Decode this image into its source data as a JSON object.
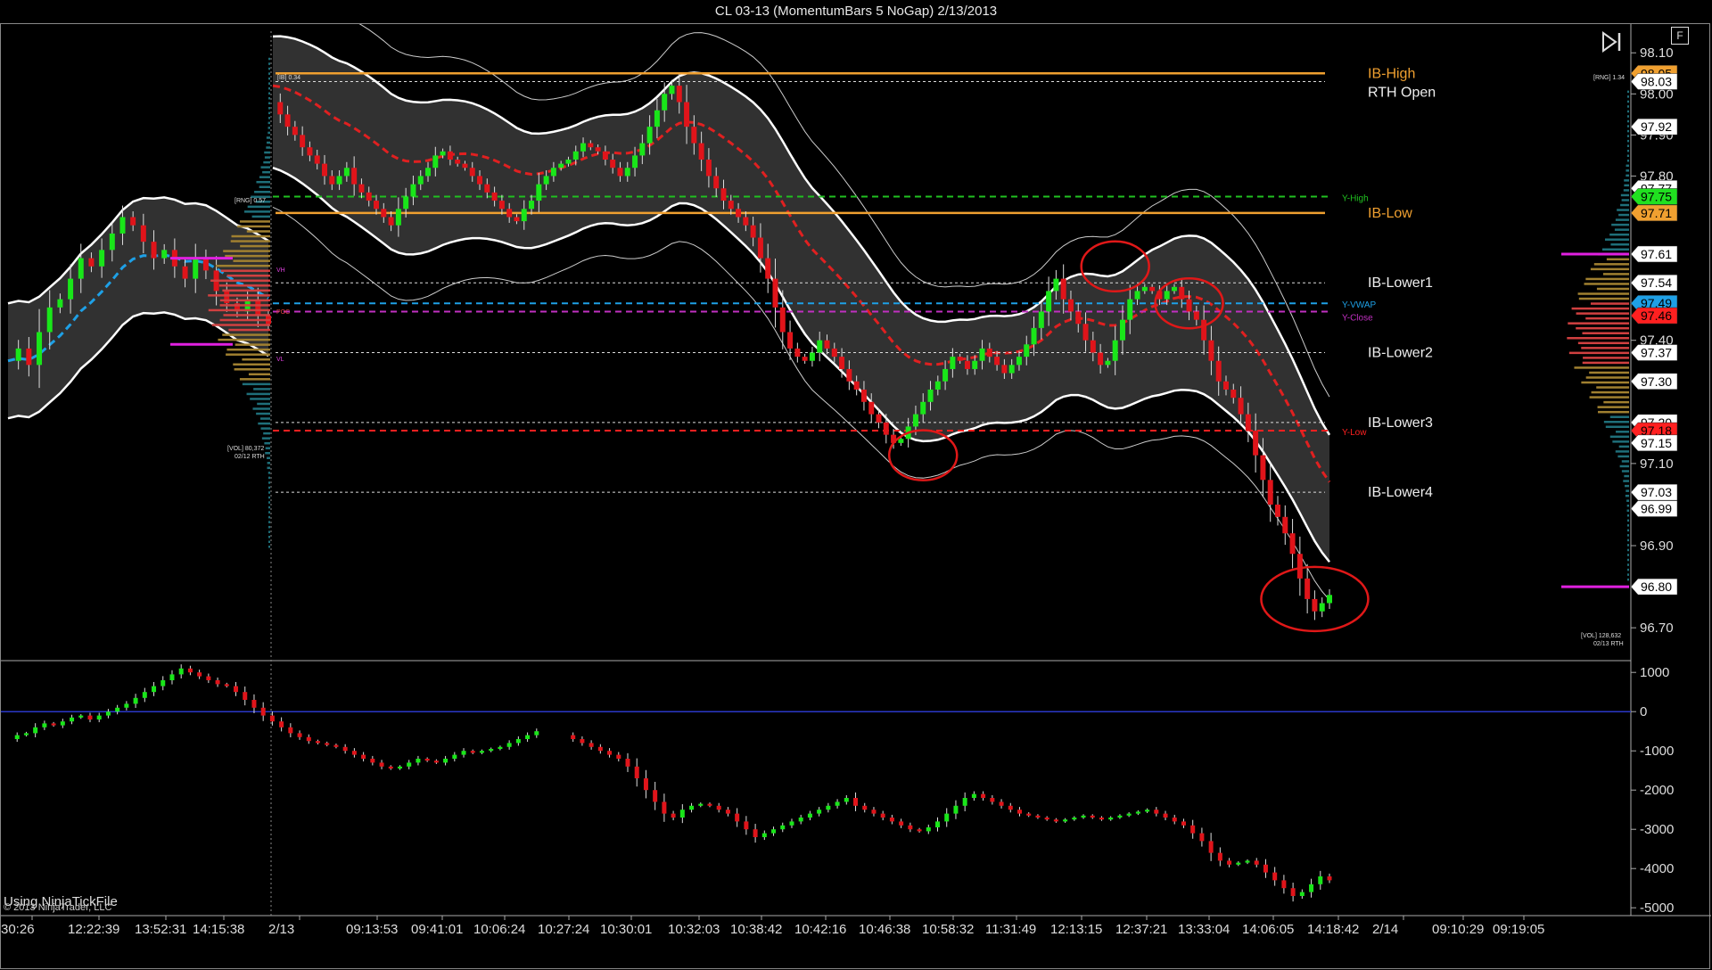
{
  "window": {
    "title": "CL 03-13 (MomentumBars 5 NoGap)  2/13/2013"
  },
  "buttons": {
    "f_label": "F"
  },
  "footer": {
    "source_text": "Using NinjaTickFile",
    "copyright": "© 2013 NinjaTrader, LLC"
  },
  "colors": {
    "up": "#19e619",
    "down": "#e0141a",
    "ib": "#f0a030",
    "ylow": "#ff2020",
    "yhigh": "#20c020",
    "vwap": "#1ea0e6",
    "yclose": "#c030c0",
    "price_mid": "#e02020"
  },
  "icons": {
    "skip_to_end": "skip-to-end-icon"
  },
  "chart_data": [
    {
      "type": "candlestick",
      "name_printed": "",
      "y_ticks": [
        "98.10",
        "98.00",
        "97.90",
        "97.80",
        "97.40",
        "97.10",
        "96.90",
        "96.70"
      ],
      "ylim": [
        96.62,
        98.17
      ],
      "x_ticks": [
        "30:26",
        "12:22:39",
        "13:52:31",
        "14:15:38",
        "2/13",
        "09:13:53",
        "09:41:01",
        "10:06:24",
        "10:27:24",
        "10:30:01",
        "10:32:03",
        "10:38:42",
        "10:42:16",
        "10:46:38",
        "10:58:32",
        "11:31:49",
        "12:13:15",
        "12:37:21",
        "13:33:04",
        "14:06:05",
        "14:18:42",
        "2/14",
        "09:10:29",
        "09:19:05"
      ],
      "level_lines": [
        {
          "label": "IB-High",
          "value": 98.05,
          "style": "ib"
        },
        {
          "label": "RTH Open",
          "value": 98.03,
          "style": "white"
        },
        {
          "label": "IB-Low",
          "value": 97.71,
          "style": "ib"
        },
        {
          "label": "Y-High",
          "value": 97.75,
          "style": "yhigh"
        },
        {
          "label": "IB-Lower1",
          "value": 97.54,
          "style": "white"
        },
        {
          "label": "Y-VWAP",
          "value": 97.49,
          "style": "vwap"
        },
        {
          "label": "Y-Close",
          "value": 97.47,
          "style": "yclose"
        },
        {
          "label": "IB-Lower2",
          "value": 97.37,
          "style": "white"
        },
        {
          "label": "IB-Lower3",
          "value": 97.2,
          "style": "white"
        },
        {
          "label": "Y-Low",
          "value": 97.18,
          "style": "ylow"
        },
        {
          "label": "IB-Lower4",
          "value": 97.03,
          "style": "white"
        }
      ],
      "price_badges": [
        {
          "text": "98.05",
          "value": 98.05,
          "bg": "#f0a030",
          "fg": "#000"
        },
        {
          "text": "98.03",
          "value": 98.03,
          "bg": "#ffffff",
          "fg": "#000"
        },
        {
          "text": "97.92",
          "value": 97.92,
          "bg": "#ffffff",
          "fg": "#000"
        },
        {
          "text": "97.77",
          "value": 97.77,
          "bg": "#ffffff",
          "fg": "#000"
        },
        {
          "text": "97.75",
          "value": 97.75,
          "bg": "#20e020",
          "fg": "#000"
        },
        {
          "text": "97.71",
          "value": 97.71,
          "bg": "#f0a030",
          "fg": "#000"
        },
        {
          "text": "97.61",
          "value": 97.61,
          "bg": "#ffffff",
          "fg": "#000"
        },
        {
          "text": "97.54",
          "value": 97.54,
          "bg": "#ffffff",
          "fg": "#000"
        },
        {
          "text": "97.49",
          "value": 97.49,
          "bg": "#1ea0e6",
          "fg": "#000"
        },
        {
          "text": "97.46",
          "value": 97.46,
          "bg": "#ff2020",
          "fg": "#000"
        },
        {
          "text": "97.37",
          "value": 97.37,
          "bg": "#ffffff",
          "fg": "#000"
        },
        {
          "text": "97.30",
          "value": 97.3,
          "bg": "#ffffff",
          "fg": "#000"
        },
        {
          "text": "97.20",
          "value": 97.2,
          "bg": "#ffffff",
          "fg": "#000"
        },
        {
          "text": "97.18",
          "value": 97.18,
          "bg": "#ff2020",
          "fg": "#000"
        },
        {
          "text": "97.15",
          "value": 97.15,
          "bg": "#ffffff",
          "fg": "#000"
        },
        {
          "text": "97.03",
          "value": 97.03,
          "bg": "#ffffff",
          "fg": "#000"
        },
        {
          "text": "96.99",
          "value": 96.99,
          "bg": "#ffffff",
          "fg": "#000"
        },
        {
          "text": "96.80",
          "value": 96.8,
          "bg": "#ffffff",
          "fg": "#000"
        }
      ],
      "annotations": [
        "[IB] 0.34",
        "[RNG] 0.57",
        "VH",
        "POC",
        "VL",
        "[VOL] 80,372",
        "02/12 RTH",
        "[RNG] 1.34",
        "[VOL] 128,632",
        "02/13 RTH"
      ],
      "prev_session_closes": [
        97.35,
        97.38,
        97.34,
        97.42,
        97.48,
        97.5,
        97.55,
        97.6,
        97.58,
        97.62,
        97.66,
        97.7,
        97.68,
        97.64,
        97.6,
        97.62,
        97.58,
        97.55,
        97.6,
        97.57,
        97.52,
        97.49,
        97.47,
        97.5,
        97.46,
        97.44
      ],
      "session_closes": [
        97.98,
        97.95,
        97.92,
        97.9,
        97.87,
        97.85,
        97.83,
        97.8,
        97.78,
        97.8,
        97.82,
        97.78,
        97.76,
        97.74,
        97.72,
        97.7,
        97.68,
        97.72,
        97.75,
        97.78,
        97.8,
        97.82,
        97.85,
        97.86,
        97.84,
        97.83,
        97.82,
        97.8,
        97.78,
        97.76,
        97.74,
        97.72,
        97.7,
        97.69,
        97.72,
        97.74,
        97.78,
        97.8,
        97.82,
        97.83,
        97.84,
        97.86,
        97.88,
        97.87,
        97.86,
        97.84,
        97.82,
        97.8,
        97.82,
        97.85,
        97.88,
        97.92,
        97.96,
        98.0,
        98.02,
        97.98,
        97.92,
        97.88,
        97.84,
        97.8,
        97.77,
        97.74,
        97.72,
        97.7,
        97.68,
        97.65,
        97.6,
        97.55,
        97.48,
        97.42,
        97.38,
        97.36,
        97.35,
        97.37,
        97.4,
        97.38,
        97.36,
        97.33,
        97.3,
        97.28,
        97.25,
        97.22,
        97.2,
        97.17,
        97.15,
        97.16,
        97.19,
        97.22,
        97.25,
        97.28,
        97.3,
        97.33,
        97.36,
        97.35,
        97.33,
        97.35,
        97.38,
        97.36,
        97.34,
        97.32,
        97.34,
        97.36,
        97.39,
        97.43,
        97.47,
        97.52,
        97.55,
        97.5,
        97.47,
        97.44,
        97.4,
        97.37,
        97.34,
        97.35,
        97.4,
        97.45,
        97.5,
        97.52,
        97.53,
        97.52,
        97.5,
        97.52,
        97.53,
        97.5,
        97.47,
        97.45,
        97.4,
        97.35,
        97.3,
        97.28,
        97.26,
        97.22,
        97.18,
        97.12,
        97.06,
        97.0,
        96.97,
        96.93,
        96.88,
        96.82,
        96.77,
        96.74,
        96.76,
        96.78
      ],
      "highlighted_circles": [
        {
          "bar_index": 88,
          "value": 97.12
        },
        {
          "bar_index": 114,
          "value": 97.58
        },
        {
          "bar_index": 124,
          "value": 97.49
        },
        {
          "bar_index": 141,
          "value": 96.77
        }
      ]
    },
    {
      "type": "candlestick",
      "name_printed": "",
      "y_ticks": [
        "1000",
        "0",
        "-1000",
        "-2000",
        "-3000",
        "-4000",
        "-5000"
      ],
      "ylim": [
        -5200,
        1300
      ],
      "zero_line": 0,
      "closes": [
        -700,
        -600,
        -550,
        -400,
        -300,
        -350,
        -250,
        -150,
        -100,
        -200,
        -100,
        0,
        100,
        200,
        350,
        500,
        650,
        800,
        950,
        1100,
        1000,
        900,
        800,
        700,
        650,
        500,
        300,
        100,
        -100,
        -250,
        -400,
        -550,
        -650,
        -750,
        -800,
        -850,
        -900,
        -1000,
        -1100,
        -1200,
        -1300,
        -1400,
        -1450,
        -1400,
        -1300,
        -1200,
        -1250,
        -1300,
        -1200,
        -1100,
        -1000,
        -1050,
        -1000,
        -950,
        -900,
        -800,
        -700,
        -600,
        -500,
        -450,
        -500,
        -600,
        -700,
        -800,
        -900,
        -1000,
        -1100,
        -1200,
        -1400,
        -1700,
        -2000,
        -2300,
        -2600,
        -2700,
        -2500,
        -2400,
        -2350,
        -2400,
        -2500,
        -2600,
        -2800,
        -3000,
        -3200,
        -3100,
        -3000,
        -2900,
        -2800,
        -2700,
        -2600,
        -2500,
        -2400,
        -2300,
        -2200,
        -2400,
        -2500,
        -2600,
        -2700,
        -2800,
        -2900,
        -3000,
        -3050,
        -2950,
        -2800,
        -2600,
        -2400,
        -2200,
        -2100,
        -2200,
        -2300,
        -2400,
        -2500,
        -2600,
        -2650,
        -2700,
        -2750,
        -2800,
        -2750,
        -2700,
        -2650,
        -2700,
        -2750,
        -2700,
        -2650,
        -2600,
        -2550,
        -2500,
        -2600,
        -2700,
        -2800,
        -2900,
        -3100,
        -3300,
        -3600,
        -3800,
        -3900,
        -3850,
        -3800,
        -3900,
        -4100,
        -4300,
        -4500,
        -4700,
        -4600,
        -4400,
        -4200,
        -4300
      ],
      "gap_index_range": [
        59,
        61
      ]
    }
  ]
}
